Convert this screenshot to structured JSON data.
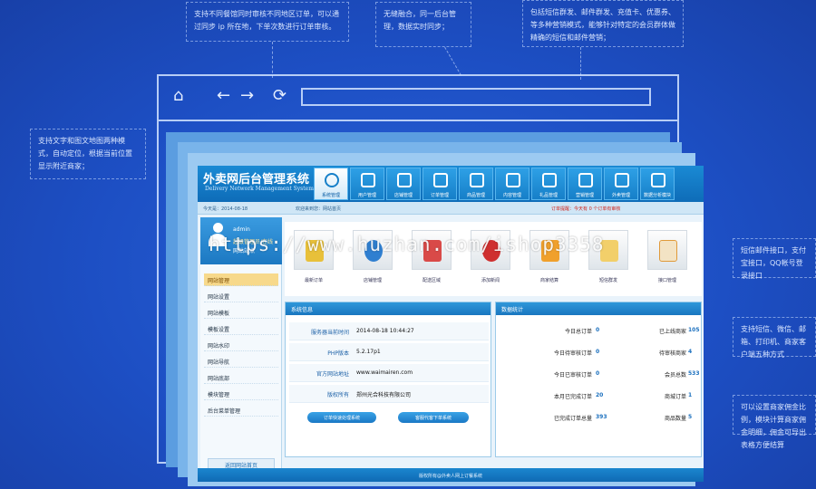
{
  "callouts": {
    "top_left": "支持不同餐馆同时审核不同地区订单，可以通过同步 ip 所在地，下单次数进行订单审核。",
    "top_mid": "无缝融合，同一后台管理，数据实时同步；",
    "top_right": "包括短信群发、邮件群发、充值卡、优惠券、等多种营销模式，能够针对特定的会员群体做精确的短信和邮件营销；",
    "left": "支持文字和图文地图两种模式，自动定位，根据当前位置显示附近商家；",
    "right_1": "短信邮件接口，支付宝接口，QQ帐号登录接口",
    "right_2": "支持短信、微信、邮箱、打印机、商家客户端五种方式",
    "right_3": "可以设置商家佣金比例，模块计算商家佣金明细，佣金可导出表格方便结算"
  },
  "browser": {
    "home_icon": "home-icon",
    "back_icon": "arrow-left-icon",
    "forward_icon": "arrow-right-icon",
    "refresh_icon": "refresh-icon"
  },
  "app": {
    "title": "外卖网后台管理系统",
    "subtitle": "Delivery Network Management System",
    "menu": [
      {
        "label": "系统管理",
        "active": true
      },
      {
        "label": "用户管理"
      },
      {
        "label": "店铺管理"
      },
      {
        "label": "订单管理"
      },
      {
        "label": "商品管理"
      },
      {
        "label": "内容管理"
      },
      {
        "label": "礼品管理"
      },
      {
        "label": "营销管理"
      },
      {
        "label": "外卖管理"
      },
      {
        "label": "数据分析模块"
      }
    ],
    "info_bar": {
      "date": "今天是：2014-08-18",
      "notice": "欢迎来到您：网站首页",
      "alert": "订单提醒：今天有 0 个订单有审核"
    },
    "profile": {
      "name": "admin",
      "role": "超级管理员/在线",
      "role2": "网站站点"
    },
    "side_items": [
      "网站管理",
      "网站设置",
      "网站模板",
      "模板设置",
      "网站水印",
      "网站导航",
      "网站底部",
      "模块管理",
      "后台菜单管理"
    ],
    "side_link": "返回网站首页",
    "quick_tiles": [
      "最新订单",
      "店铺管理",
      "配送区域",
      "添加新闻",
      "商家结算",
      "短信群发",
      "接口管理"
    ],
    "system_panel": {
      "title": "系统信息",
      "rows": [
        {
          "label": "服务器当前时间",
          "value": "2014-08-18 10:44:27"
        },
        {
          "label": "PHP版本",
          "value": "5.2.17p1"
        },
        {
          "label": "官方网站地址",
          "value": "www.waimairen.com"
        },
        {
          "label": "版权所有",
          "value": "郑州光合科技有限公司"
        }
      ],
      "btn_left": "订单快速处理系统",
      "btn_right": "客服代客下单系统"
    },
    "stats_panel": {
      "title": "数据统计",
      "left": [
        {
          "label": "今日总订单",
          "value": "0"
        },
        {
          "label": "今日待审核订单",
          "value": "0"
        },
        {
          "label": "今日已审核订单",
          "value": "0"
        },
        {
          "label": "本月已完成订单",
          "value": "20"
        },
        {
          "label": "已完成订单总量",
          "value": "393"
        }
      ],
      "right": [
        {
          "label": "已上线商家",
          "value": "105"
        },
        {
          "label": "待审核商家",
          "value": "4"
        },
        {
          "label": "会员总数",
          "value": "533"
        },
        {
          "label": "商城订单",
          "value": "1"
        },
        {
          "label": "商品数量",
          "value": "5"
        }
      ]
    },
    "footer": "版权所有@外卖人网上订餐系统"
  },
  "watermark": "https://www.huzhan.com/ishop3358",
  "colors": {
    "background": "#1d4fc4",
    "accent": "#1a8ad4",
    "highlight": "#f7d98b"
  }
}
